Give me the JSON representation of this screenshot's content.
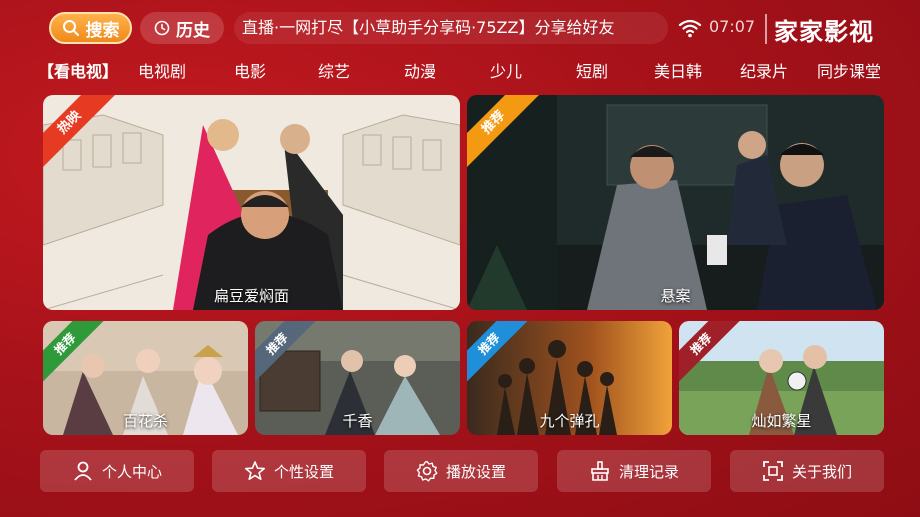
{
  "header": {
    "search_label": "搜索",
    "history_label": "历史",
    "marquee": "直播·一网打尽【小草助手分享码·75ZZ】分享给好友",
    "time": "07:07",
    "brand": "家家影视"
  },
  "nav": [
    "【看电视】",
    "电视剧",
    "电影",
    "综艺",
    "动漫",
    "少儿",
    "短剧",
    "美日韩",
    "纪录片",
    "同步课堂"
  ],
  "featured": [
    {
      "title": "扁豆爱焖面",
      "badge": "热映",
      "badge_color": "#e63a22"
    },
    {
      "title": "悬案",
      "badge": "推荐",
      "badge_color": "#f39a12"
    }
  ],
  "recommended": [
    {
      "title": "百花杀",
      "badge": "推荐",
      "badge_color": "#2f9a3a"
    },
    {
      "title": "千香",
      "badge": "推荐",
      "badge_color": "#55677a"
    },
    {
      "title": "九个弹孔",
      "badge": "推荐",
      "badge_color": "#1e8fd8"
    },
    {
      "title": "灿如繁星",
      "badge": "推荐",
      "badge_color": "#a0202a"
    }
  ],
  "bottom": {
    "profile": "个人中心",
    "personalize": "个性设置",
    "playback": "播放设置",
    "clear": "清理记录",
    "about": "关于我们"
  },
  "colors": {
    "accent": "#f08a1c",
    "background": "#a8121a"
  }
}
